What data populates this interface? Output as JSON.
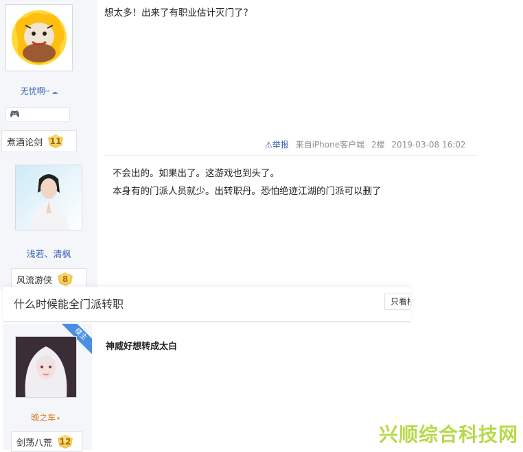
{
  "post1": {
    "username": "无忧啊",
    "rank_title": "煮酒论剑",
    "rank_level": "11",
    "content": "想太多！出来了有职业估计灭门了？",
    "report_label": "举报",
    "source": "来自iPhone客户端",
    "floor": "2楼",
    "time": "2019-03-08 16:02"
  },
  "post2": {
    "username": "浅若、清枫",
    "rank_title": "风流游侠",
    "rank_level": "8",
    "content_lines": [
      "不会出的。如果出了。这游戏也到头了。",
      "本身有的门派人员就少。出转职丹。恐怕绝迹江湖的门派可以删了"
    ]
  },
  "thread2": {
    "title": "什么时候能全门派转职",
    "only_host_btn": "只看楼",
    "corner_badge": "楼主"
  },
  "post3": {
    "username": "晚之车",
    "rank_title": "剑荡八荒",
    "rank_level": "12",
    "content": "神威好想转成太白"
  },
  "watermark": "兴顺综合科技网"
}
